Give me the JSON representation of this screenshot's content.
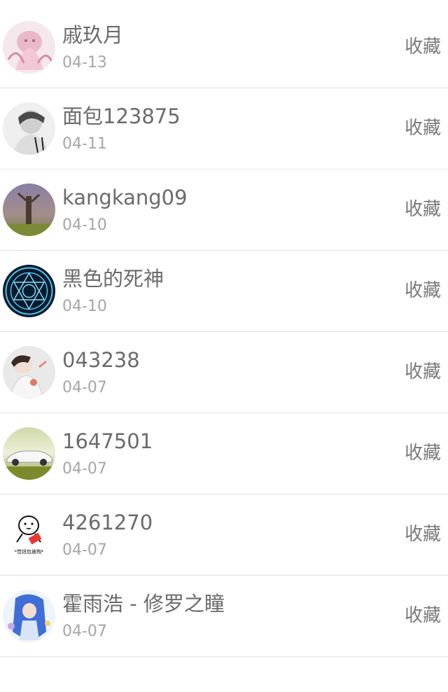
{
  "list": {
    "items": [
      {
        "name": "戚玖月",
        "date": "04-13",
        "action": "收藏",
        "avatar": "anime-girl-pink"
      },
      {
        "name": "面包123875",
        "date": "04-11",
        "action": "收藏",
        "avatar": "bw-portrait"
      },
      {
        "name": "kangkang09",
        "date": "04-10",
        "action": "收藏",
        "avatar": "tree-landscape"
      },
      {
        "name": "黑色的死神",
        "date": "04-10",
        "action": "收藏",
        "avatar": "magic-circle"
      },
      {
        "name": "043238",
        "date": "04-07",
        "action": "收藏",
        "avatar": "illustration-person"
      },
      {
        "name": "1647501",
        "date": "04-07",
        "action": "收藏",
        "avatar": "white-car"
      },
      {
        "name": "4261270",
        "date": "04-07",
        "action": "收藏",
        "avatar": "meme-face"
      },
      {
        "name": "霍雨浩 - 修罗之瞳",
        "date": "04-07",
        "action": "收藏",
        "avatar": "anime-character-blue"
      }
    ]
  },
  "meme_caption": "*觉钱包被掏*"
}
